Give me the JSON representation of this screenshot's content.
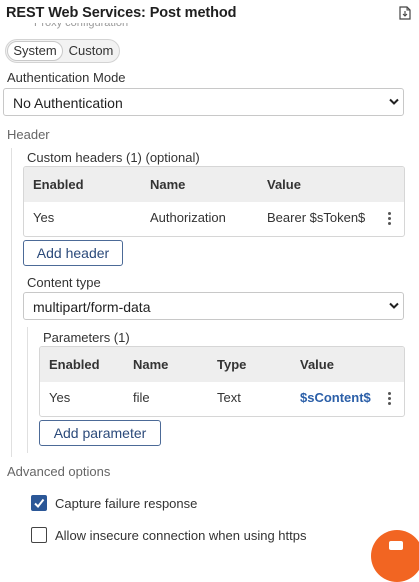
{
  "header": {
    "title": "REST Web Services: Post method",
    "export_icon": "export-file-icon",
    "cut_label": "Proxy configuration"
  },
  "proxy_toggle": {
    "options": [
      "System",
      "Custom"
    ],
    "selected": "System"
  },
  "auth": {
    "label": "Authentication Mode",
    "value": "No Authentication"
  },
  "header_section": {
    "label": "Header",
    "custom_headers_label": "Custom headers (1) (optional)",
    "columns": [
      "Enabled",
      "Name",
      "Value"
    ],
    "rows": [
      {
        "enabled": "Yes",
        "name": "Authorization",
        "value": "Bearer $sToken$"
      }
    ],
    "add_button": "Add header"
  },
  "content_type": {
    "label": "Content type",
    "value": "multipart/form-data",
    "parameters_label": "Parameters (1)",
    "columns": [
      "Enabled",
      "Name",
      "Type",
      "Value"
    ],
    "rows": [
      {
        "enabled": "Yes",
        "name": "file",
        "type": "Text",
        "value": "$sContent$"
      }
    ],
    "add_button": "Add parameter"
  },
  "advanced": {
    "label": "Advanced options",
    "capture_failure": {
      "label": "Capture failure response",
      "checked": true
    },
    "allow_insecure": {
      "label": "Allow insecure connection when using https",
      "checked": false
    }
  },
  "colors": {
    "accent": "#2b5797",
    "link": "#2b5fa8",
    "fab": "#f26522"
  },
  "fab_icon": "chat-icon"
}
